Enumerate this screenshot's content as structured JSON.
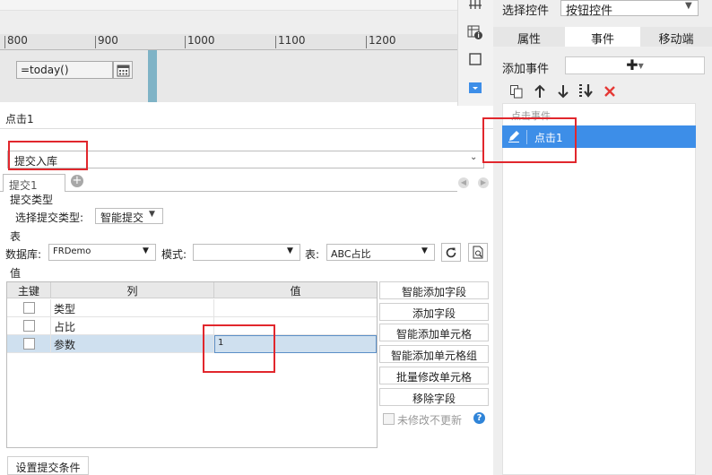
{
  "ruler": {
    "ticks": [
      "800",
      "900",
      "1000",
      "1100",
      "1200"
    ]
  },
  "canvas": {
    "date_field_value": "=today()"
  },
  "right_panel": {
    "select_control_label": "选择控件",
    "select_control_value": "按钮控件",
    "tabs": [
      "属性",
      "事件",
      "移动端"
    ],
    "add_event_label": "添加事件",
    "event_group_label": "点击事件",
    "event_item_label": "点击1"
  },
  "form": {
    "title": "点击1",
    "action_value": "提交入库",
    "sub_tab_label": "提交1",
    "submit_type_section": "提交类型",
    "submit_type_label": "选择提交类型:",
    "submit_type_value": "智能提交",
    "table_section": "表",
    "db_label": "数据库:",
    "db_value": "FRDemo",
    "mode_label": "模式:",
    "mode_value": "",
    "table_label": "表:",
    "table_value": "ABC占比",
    "values_section": "值",
    "grid_headers": [
      "主键",
      "列",
      "值"
    ],
    "grid_rows": [
      {
        "column": "类型",
        "value": ""
      },
      {
        "column": "占比",
        "value": ""
      },
      {
        "column": "参数",
        "value": "1"
      }
    ],
    "side_buttons": [
      "智能添加字段",
      "添加字段",
      "智能添加单元格",
      "智能添加单元格组",
      "批量修改单元格",
      "移除字段"
    ],
    "no_update_label": "未修改不更新",
    "condition_button": "设置提交条件"
  },
  "colors": {
    "accent": "#3d8ee8",
    "highlight": "#e1272d",
    "delete": "#e53935"
  }
}
